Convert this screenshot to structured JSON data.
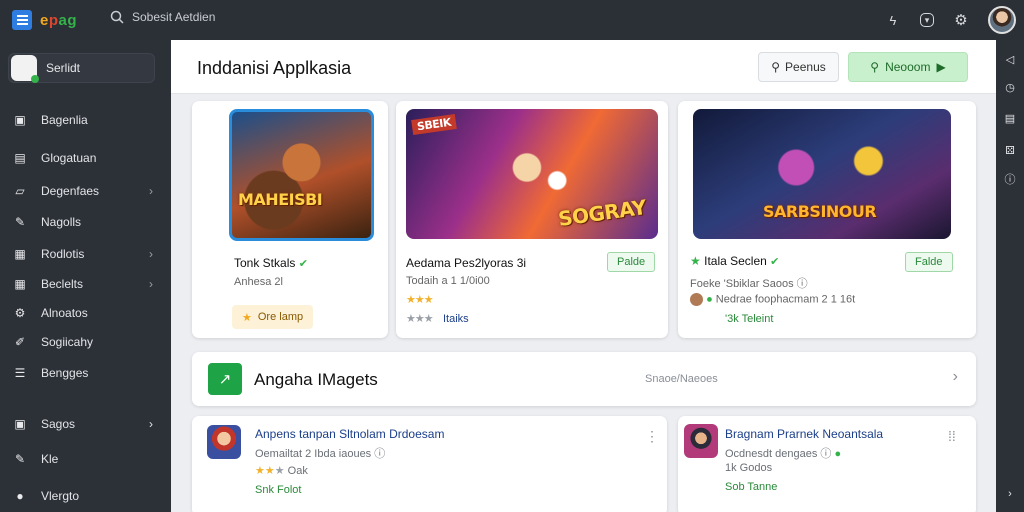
{
  "topbar": {
    "logo": [
      "e",
      "p",
      "ag"
    ],
    "search_text": "Sobesit Aetdien",
    "icons": [
      "bolt-icon",
      "download-icon",
      "settings-icon"
    ]
  },
  "sidebar": {
    "search_label": "Serlidt",
    "items": [
      {
        "label": "Bagenlia",
        "icon": "book-icon",
        "chevron": false
      },
      {
        "label": "Glogatuan",
        "icon": "chat-icon",
        "chevron": false
      },
      {
        "label": "Degenfaes",
        "icon": "folder-icon",
        "chevron": true
      },
      {
        "label": "Nagolls",
        "icon": "pencil-icon",
        "chevron": false
      },
      {
        "label": "Rodlotis",
        "icon": "gamepad-icon",
        "chevron": true
      },
      {
        "label": "Beclelts",
        "icon": "grid-icon",
        "chevron": true
      },
      {
        "label": "Alnoatos",
        "icon": "gear-icon",
        "chevron": false
      },
      {
        "label": "Sogiicahy",
        "icon": "wand-icon",
        "chevron": false
      },
      {
        "label": "Bengges",
        "icon": "list-icon",
        "chevron": false
      },
      {
        "label": "Sagos",
        "icon": "book2-icon",
        "chevron": true
      },
      {
        "label": "Kle",
        "icon": "tool-icon",
        "chevron": false
      },
      {
        "label": "Vlergto",
        "icon": "user-icon",
        "chevron": false
      }
    ]
  },
  "header": {
    "title": "Inddanisi Applkasia",
    "secondary_button": "Peenus",
    "primary_button": "Neooom"
  },
  "games": [
    {
      "art_text": "MAHEISBI",
      "title": "Tonk Stkals",
      "subtitle": "Anhesa 2l",
      "chip": "Ore lamp"
    },
    {
      "art_text": "SOGRAY",
      "art_banner": "SBEIK",
      "title": "Aedama Pes2lyoras 3i",
      "subtitle": "Todaih a 1 1/0i00",
      "stars": "★★★",
      "stars_grey": "★★★",
      "rating_label": "Itaiks",
      "badge": "Palde"
    },
    {
      "art_text": "SARBSINOUR",
      "title": "Itala Seclen",
      "subtitle": "Foeke 'Sbiklar Saoos",
      "detail": "Nedrae foophacmam 2 1 16t",
      "green_text": "'3k Teleint",
      "badge": "Falde"
    }
  ],
  "section": {
    "title": "Angaha IMagets",
    "link": "Snaoe/Naeoes"
  },
  "list": [
    {
      "title": "Anpens tanpan Sltnolam Drdoesam",
      "subtitle": "Oemailtat 2 Ibda iaoues",
      "stars": "★★",
      "stars_grey": "★",
      "rating": "Oak",
      "green_text": "Snk Folot"
    },
    {
      "title": "Bragnam Prarnek Neoantsala",
      "subtitle": "Ocdnesdt dengaes",
      "meta": "1k Godos",
      "green_text": "Sob Tanne"
    }
  ],
  "rail_icons": [
    "share-icon",
    "clock-icon",
    "bookmark-icon",
    "dice-icon",
    "info-icon",
    "arrow-right-icon"
  ],
  "colors": {
    "sidebar_bg": "#2c3037",
    "primary_green": "#1ea446",
    "accent_blue": "#2f7de1"
  }
}
